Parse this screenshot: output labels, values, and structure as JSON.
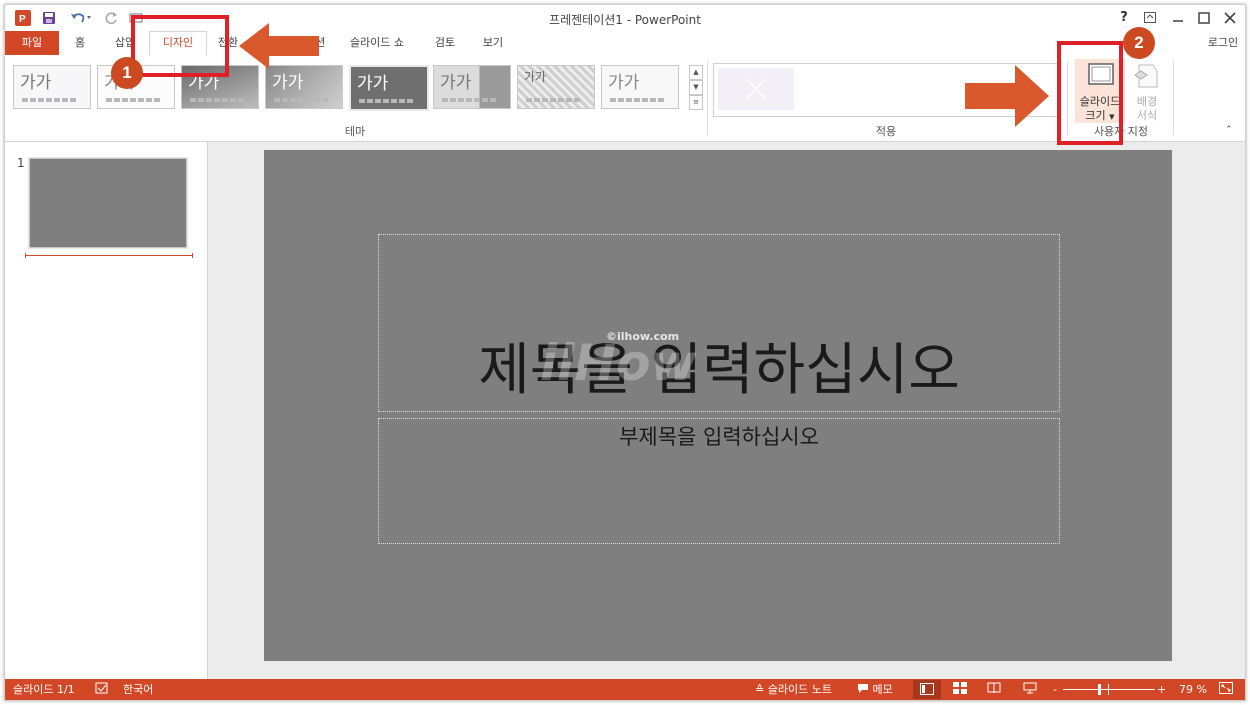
{
  "window": {
    "title": "프레젠테이션1 - PowerPoint",
    "help": "?",
    "login": "로그인"
  },
  "tabs": [
    {
      "label": "파일"
    },
    {
      "label": "홈"
    },
    {
      "label": "삽입"
    },
    {
      "label": "디자인"
    },
    {
      "label": "전환"
    },
    {
      "label": "애니메이션"
    },
    {
      "label": "슬라이드 쇼"
    },
    {
      "label": "검토"
    },
    {
      "label": "보기"
    }
  ],
  "ribbon": {
    "themes_group_label": "테마",
    "variants_group_label": "적용",
    "customize_group_label": "사용자 지정",
    "theme_sample": "가가",
    "slide_size_label_1": "슬라이드",
    "slide_size_label_2": "크기",
    "format_bg_label_1": "배경",
    "format_bg_label_2": "서식"
  },
  "slides_pane": {
    "slide_number": "1"
  },
  "slide": {
    "title_placeholder": "제목을 입력하십시오",
    "subtitle_placeholder": "부제목을 입력하십시오",
    "watermark_small": "©ilhow.com",
    "watermark_large": "ilHow"
  },
  "status": {
    "slide_count": "슬라이드 1/1",
    "language": "한국어",
    "notes": "슬라이드 노트",
    "comments": "메모",
    "zoom_minus": "-",
    "zoom_plus": "+",
    "zoom": "79 %",
    "zoom_level_fraction": 0.79
  },
  "annotations": {
    "badge_1": "1",
    "badge_2": "2"
  },
  "colors": {
    "accent": "#D24726",
    "annotation_box": "#E02027",
    "slide_bg": "#7F7F7F"
  },
  "icons": {
    "app": "powerpoint-icon",
    "save": "save-icon",
    "undo": "undo-icon",
    "redo": "redo-icon"
  }
}
